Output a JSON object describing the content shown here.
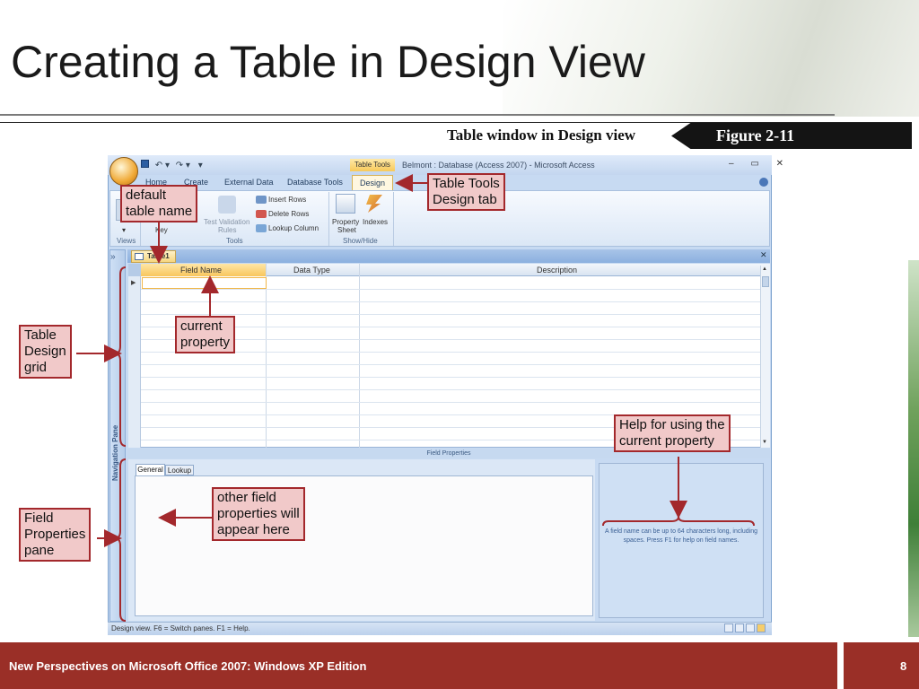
{
  "slide": {
    "title": "Creating a Table in Design View",
    "figure_caption": "Table window in Design view",
    "figure_label": "Figure  2-11",
    "footer_text": "New Perspectives on Microsoft Office 2007: Windows XP Edition",
    "page_number": "8"
  },
  "window": {
    "title": "Belmont : Database (Access 2007) - Microsoft Access",
    "context_tab_title": "Table Tools",
    "controls": "– ▭ ✕"
  },
  "ribbon": {
    "tabs": [
      "Home",
      "Create",
      "External Data",
      "Database Tools",
      "Design"
    ],
    "active_tab": "Design",
    "groups": {
      "views": "Views",
      "tools": "Tools",
      "show_hide": "Show/Hide"
    },
    "commands": {
      "primary_key": "Key",
      "test_validation": "Test Validation",
      "rules": "Rules",
      "insert_rows": "Insert Rows",
      "delete_rows": "Delete Rows",
      "lookup_column": "Lookup Column",
      "property": "Property",
      "sheet": "Sheet",
      "indexes": "Indexes"
    }
  },
  "document": {
    "tab_label": "Table1",
    "navigation_pane_label": "Navigation Pane",
    "columns": [
      "Field Name",
      "Data Type",
      "Description"
    ],
    "field_properties_label": "Field Properties",
    "property_tabs": [
      "General",
      "Lookup"
    ],
    "help_text": "A field name can be up to 64 characters long, including spaces.  Press F1 for help on field names.",
    "status_text": "Design view.  F6 = Switch panes.  F1 = Help."
  },
  "callouts": {
    "default_table_name": "default\ntable name",
    "table_tools_design_tab": "Table Tools\nDesign tab",
    "table_design_grid": "Table\nDesign\ngrid",
    "current_property": "current\nproperty",
    "help_current_property": "Help for using the\ncurrent property",
    "other_field_properties": "other field\nproperties will\nappear here",
    "field_properties_pane": "Field\nProperties\npane"
  },
  "colors": {
    "accent_red": "#a3282c",
    "footer_bg": "#9a2f27",
    "callout_fill": "#f1c9c9"
  }
}
